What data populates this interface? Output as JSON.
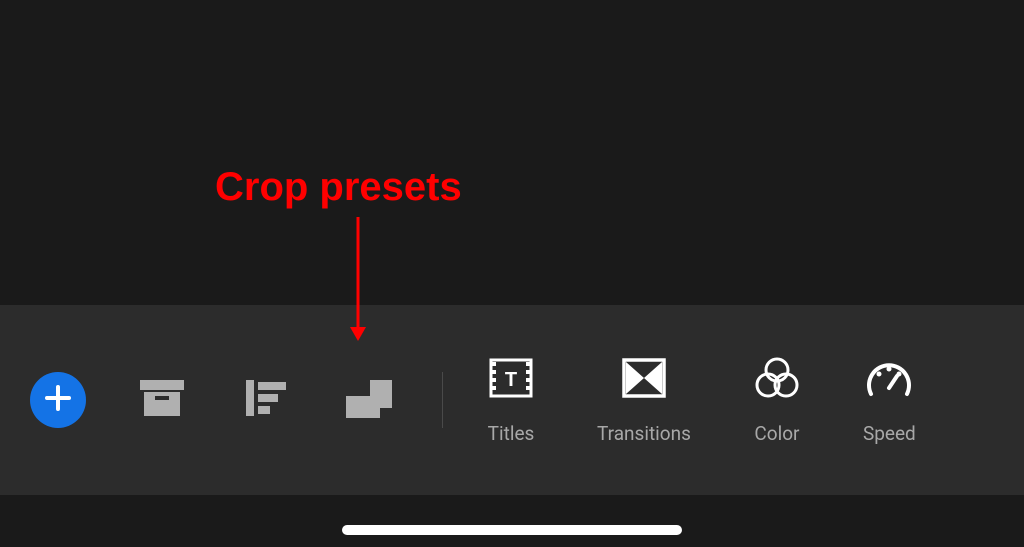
{
  "annotation": {
    "label": "Crop presets"
  },
  "toolbar": {
    "add_label": "Add",
    "project_label": "Project Assets",
    "sort_label": "Sort",
    "crop_label": "Crop Presets",
    "tools": [
      {
        "label": "Titles"
      },
      {
        "label": "Transitions"
      },
      {
        "label": "Color"
      },
      {
        "label": "Speed"
      }
    ]
  }
}
